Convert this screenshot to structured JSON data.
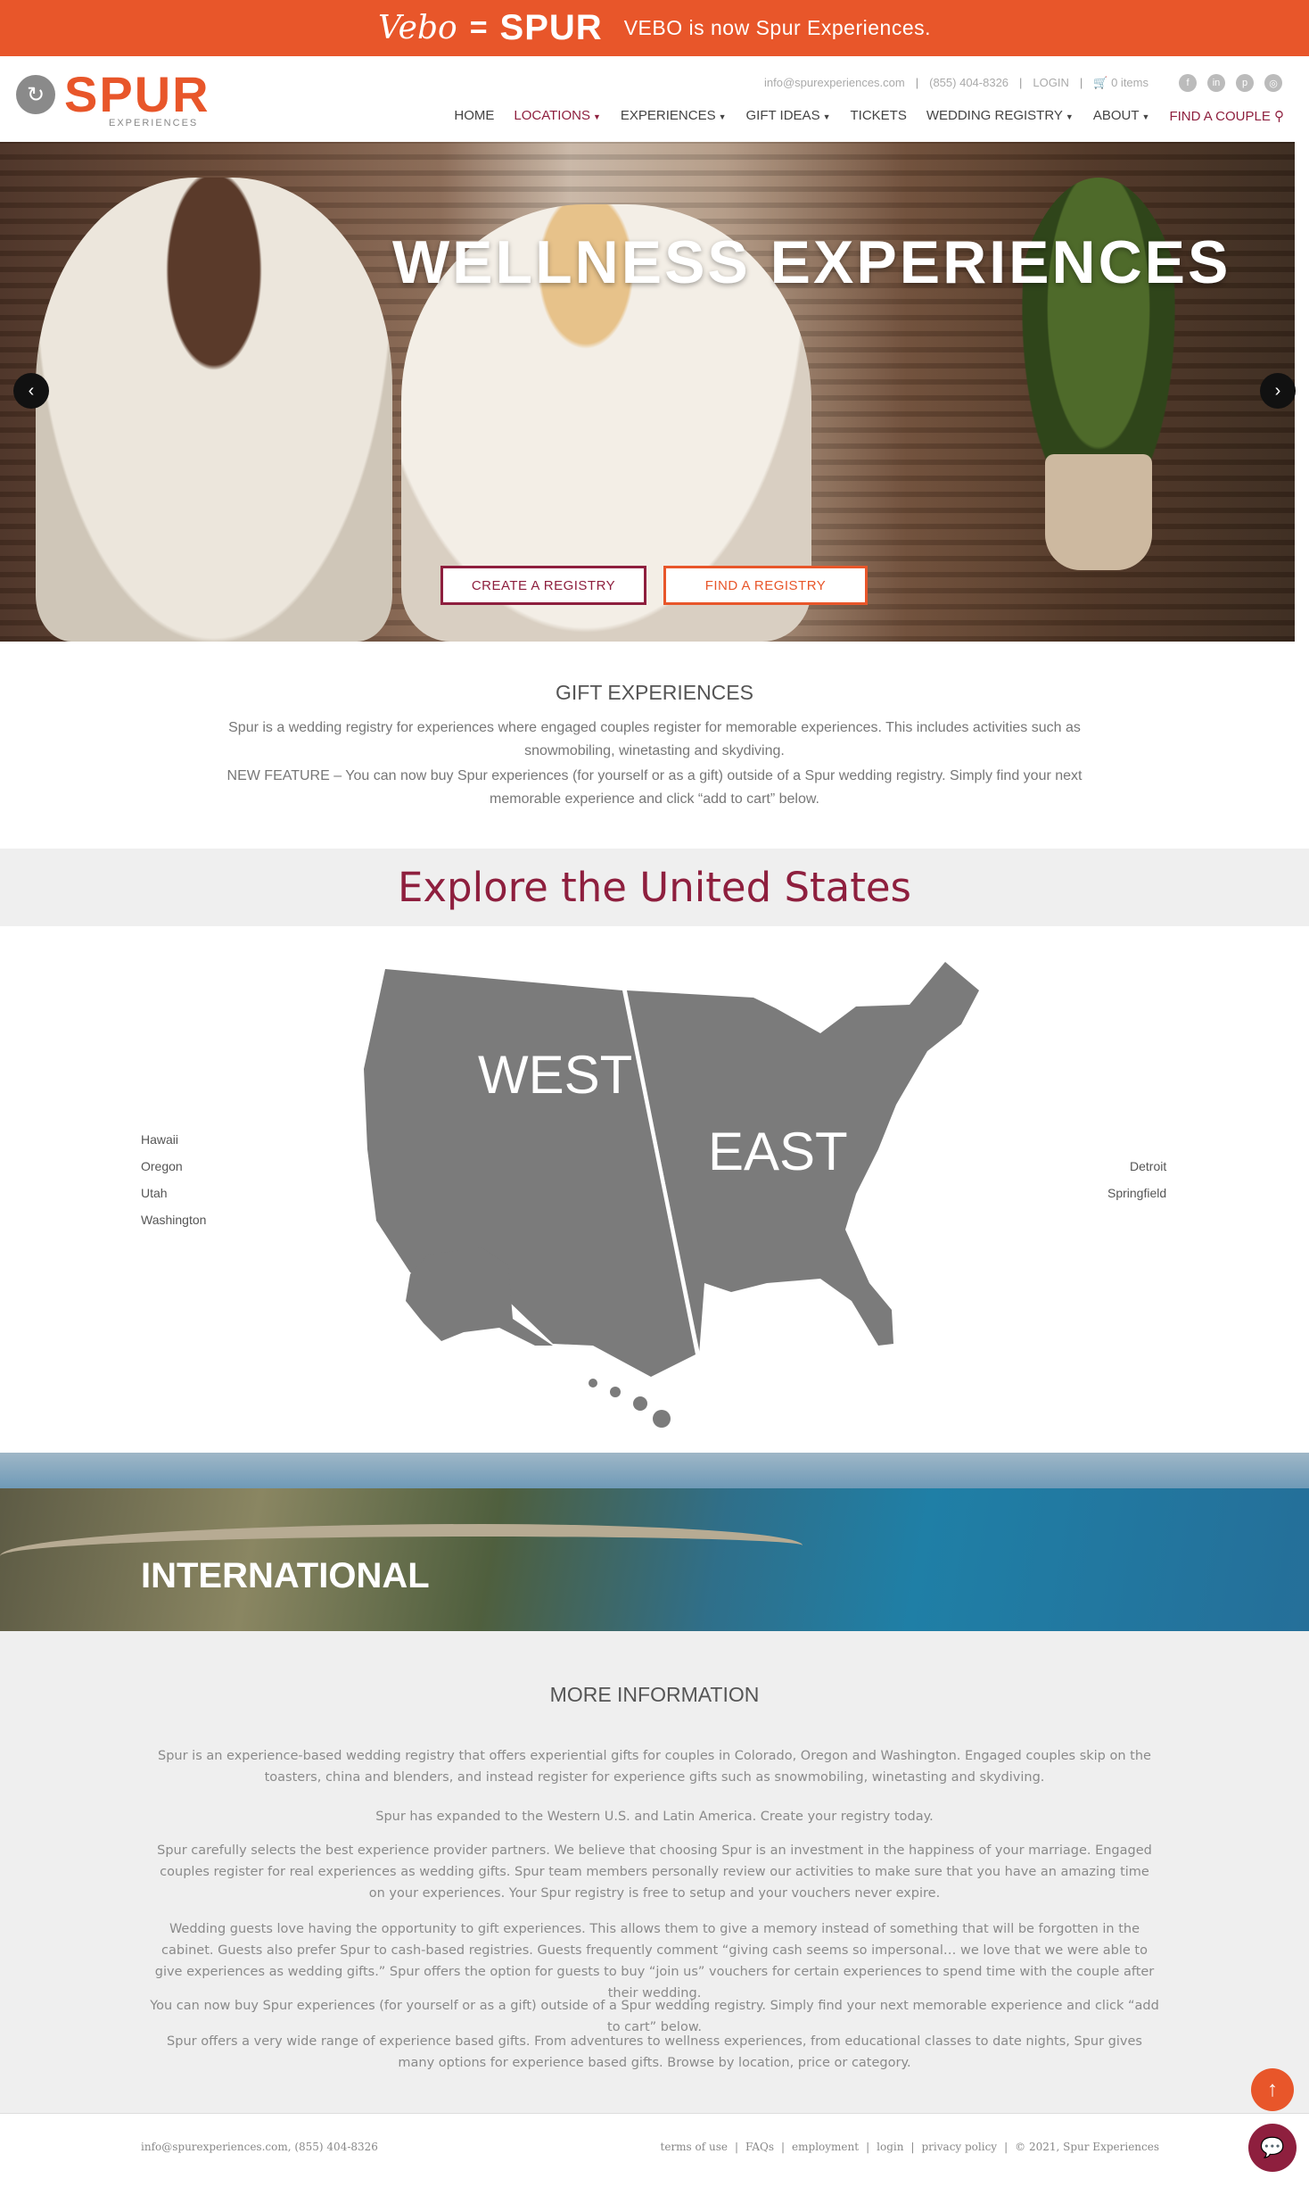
{
  "banner": {
    "vebo": "Vebo",
    "equals": "=",
    "spur": "SPUR",
    "message": "VEBO is now Spur Experiences."
  },
  "header": {
    "logo_main": "SPUR",
    "logo_sub": "EXPERIENCES",
    "email": "info@spurexperiences.com",
    "phone": "(855) 404-8326",
    "login": "LOGIN",
    "cart": "0 items",
    "social": [
      "facebook-icon",
      "linkedin-icon",
      "pinterest-icon",
      "instagram-icon"
    ],
    "nav": [
      "HOME",
      "LOCATIONS",
      "EXPERIENCES",
      "GIFT IDEAS",
      "TICKETS",
      "WEDDING REGISTRY",
      "ABOUT",
      "FIND A COUPLE"
    ]
  },
  "hero": {
    "title": "WELLNESS EXPERIENCES",
    "create_btn": "CREATE A REGISTRY",
    "find_btn": "FIND A REGISTRY"
  },
  "gift": {
    "title": "GIFT EXPERIENCES",
    "p1": "Spur is a wedding registry for experiences where engaged couples register for memorable experiences. This includes activities such as snowmobiling, winetasting and skydiving.",
    "p2": "NEW FEATURE – You can now buy Spur experiences (for yourself or as a gift) outside of a Spur wedding registry. Simply find your next memorable experience and click “add to cart” below."
  },
  "explore": {
    "title": "Explore the United States",
    "west": "WEST",
    "east": "EAST",
    "west_cities": [
      "Hawaii",
      "Oregon",
      "Utah",
      "Washington"
    ],
    "east_cities": [
      "Detroit",
      "Springfield"
    ]
  },
  "international": {
    "title": "INTERNATIONAL"
  },
  "more": {
    "title": "MORE INFORMATION",
    "p1": "Spur is an experience-based wedding registry that offers experiential gifts for couples in Colorado, Oregon and Washington. Engaged couples skip on the toasters, china and blenders, and instead register for experience gifts such as snowmobiling, winetasting and skydiving.",
    "p2": "Spur has expanded to the Western U.S. and Latin America. Create your registry today.",
    "p3": "Spur carefully selects the best experience provider partners. We believe that choosing Spur is an investment in the happiness of your marriage. Engaged couples register for real experiences as wedding gifts. Spur team members personally review our activities to make sure that you have an amazing time on your experiences. Your Spur registry is free to setup and your vouchers never expire.",
    "p4": "Wedding guests love having the opportunity to gift experiences. This allows them to give a memory instead of something that will be forgotten in the cabinet. Guests also prefer Spur to cash-based registries. Guests frequently comment “giving cash seems so impersonal… we love that we were able to give experiences as wedding gifts.” Spur offers the option for guests to buy “join us” vouchers for certain experiences to spend time with the couple after their wedding.",
    "p5": "You can now buy Spur experiences (for yourself or as a gift) outside of a Spur wedding registry. Simply find your next memorable experience and click “add to cart” below.",
    "p6": "Spur offers a very wide range of experience based gifts. From adventures to wellness experiences, from educational classes to date nights, Spur gives many options for experience based gifts. Browse by location, price or category."
  },
  "footer": {
    "contact": "info@spurexperiences.com, (855) 404-8326",
    "links": [
      "terms of use",
      "FAQs",
      "employment",
      "login",
      "privacy policy"
    ],
    "copyright": "© 2021, Spur Experiences"
  }
}
